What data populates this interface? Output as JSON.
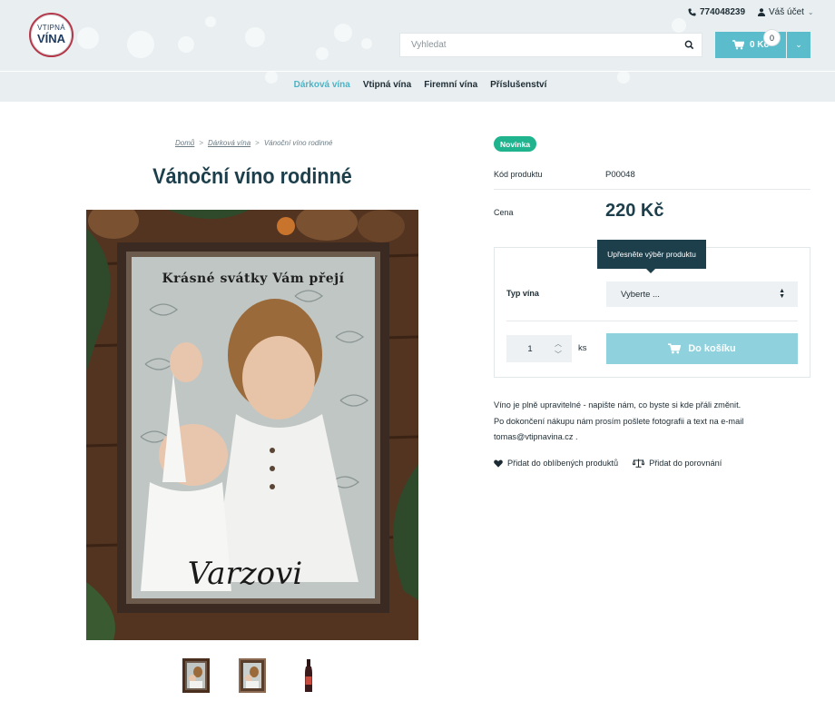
{
  "header": {
    "logo": {
      "line1": "VTIPNÁ",
      "line2": "VÍNA"
    },
    "phone": "774048239",
    "account_label": "Váš účet",
    "search": {
      "placeholder": "Vyhledat"
    },
    "cart": {
      "total": "0 Kč",
      "count": "0"
    }
  },
  "nav": {
    "items": [
      {
        "label": "Dárková vína",
        "active": true
      },
      {
        "label": "Vtipná vína",
        "active": false
      },
      {
        "label": "Firemní vína",
        "active": false
      },
      {
        "label": "Příslušenství",
        "active": false
      }
    ]
  },
  "breadcrumb": {
    "home": "Domů",
    "category": "Dárková vína",
    "current": "Vánoční víno rodinné",
    "separator": ">"
  },
  "product": {
    "title": "Vánoční víno rodinné",
    "image": {
      "greeting": "Krásné svátky Vám přejí",
      "name": "Varzovi"
    },
    "badge": "Novinka",
    "code_label": "Kód produktu",
    "code_value": "P00048",
    "price_label": "Cena",
    "price_value": "220 Kč",
    "tooltip": "Upřesněte výběr produktu",
    "variant_label": "Typ vína",
    "variant_selected": "Vyberte ...",
    "quantity": "1",
    "quantity_unit": "ks",
    "add_to_cart": "Do košíku",
    "description": [
      "Víno je plně upravitelné - napište nám, co byste si kde přáli změnit.",
      "Po dokončení nákupu nám prosím pošlete fotografii a text na e-mail",
      "tomas@vtipnavina.cz ."
    ],
    "favorite_label": "Přidat do oblíbených produktů",
    "compare_label": "Přidat do porovnání"
  },
  "colors": {
    "accent": "#5bbccc",
    "accent_light": "#8fd1dd",
    "badge": "#1fb38e",
    "heading": "#1d3f4c"
  },
  "icons": {
    "phone": "phone-icon",
    "account": "user-icon",
    "search": "search-icon",
    "cart": "cart-icon",
    "favorite": "heart-icon",
    "compare": "scales-icon"
  }
}
